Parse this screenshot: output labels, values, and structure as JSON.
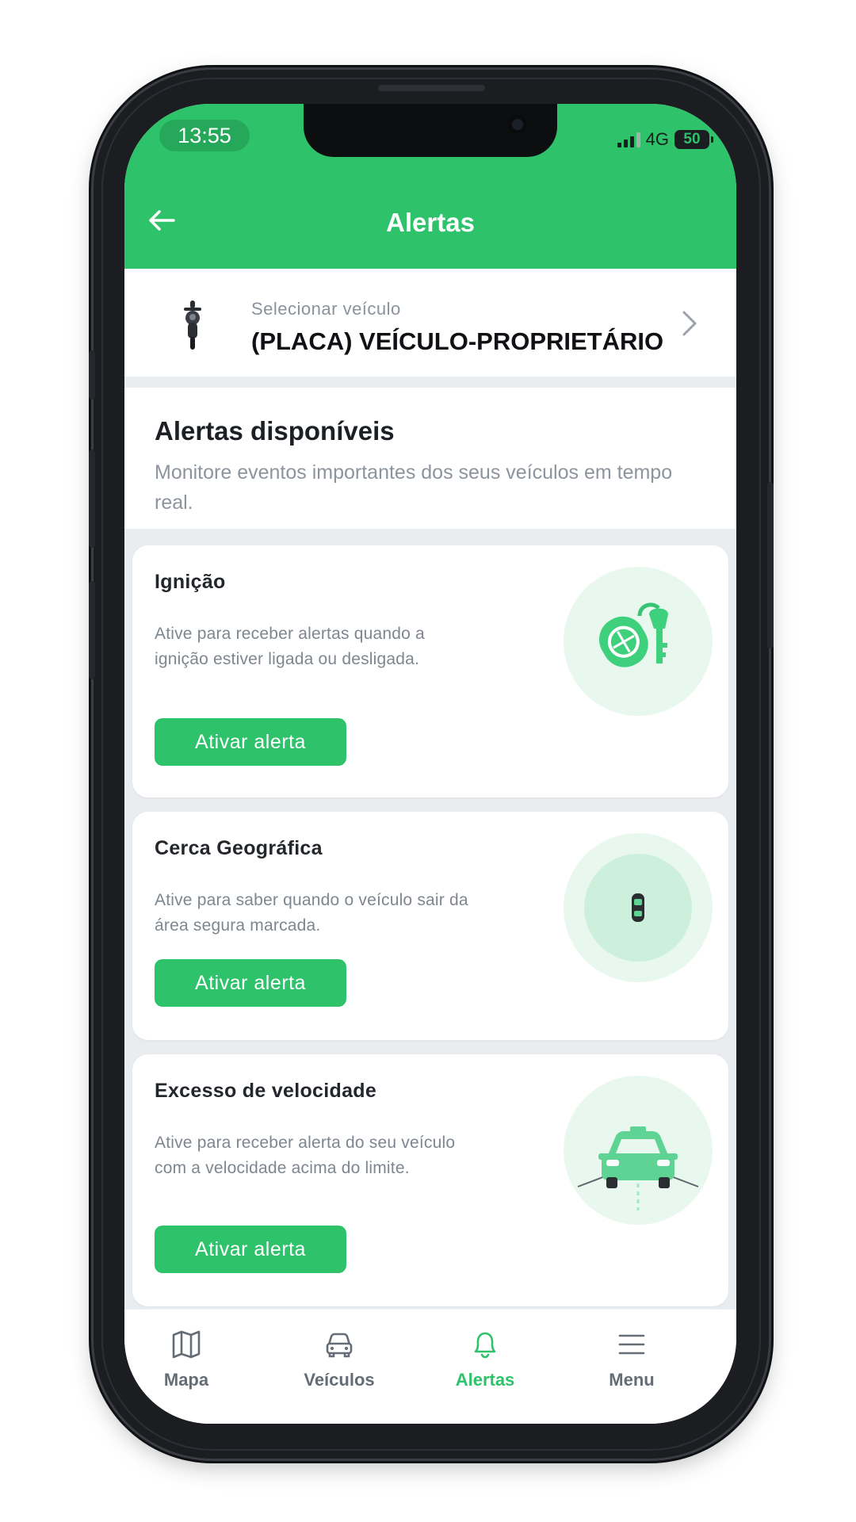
{
  "status_bar": {
    "time": "13:55",
    "network": "4G",
    "battery": "50"
  },
  "header": {
    "title": "Alertas"
  },
  "vehicle_selector": {
    "hint": "Selecionar veículo",
    "name": "(PLACA) VEÍCULO-PROPRIETÁRIO"
  },
  "intro": {
    "title": "Alertas disponíveis",
    "description": "Monitore eventos importantes dos seus veículos em tempo real."
  },
  "alerts": [
    {
      "title": "Ignição",
      "description": "Ative para receber alertas quando a ignição estiver ligada ou desligada.",
      "button": "Ativar alerta",
      "icon": "ignition-key-icon"
    },
    {
      "title": "Cerca Geográfica",
      "description": "Ative para saber quando o veículo sair da área segura marcada.",
      "button": "Ativar alerta",
      "icon": "geofence-icon"
    },
    {
      "title": "Excesso de velocidade",
      "description": "Ative para receber alerta do seu veículo com a velocidade acima do limite.",
      "button": "Ativar alerta",
      "icon": "speeding-car-icon"
    }
  ],
  "bottom_nav": {
    "items": [
      {
        "label": "Mapa",
        "icon": "map-icon",
        "active": false
      },
      {
        "label": "Veículos",
        "icon": "car-icon",
        "active": false
      },
      {
        "label": "Alertas",
        "icon": "bell-icon",
        "active": true
      },
      {
        "label": "Menu",
        "icon": "hamburger-menu-icon",
        "active": false
      }
    ]
  },
  "colors": {
    "accent": "#2ec26a",
    "accent_light": "#e9f8ef",
    "background": "#e9edf0"
  }
}
